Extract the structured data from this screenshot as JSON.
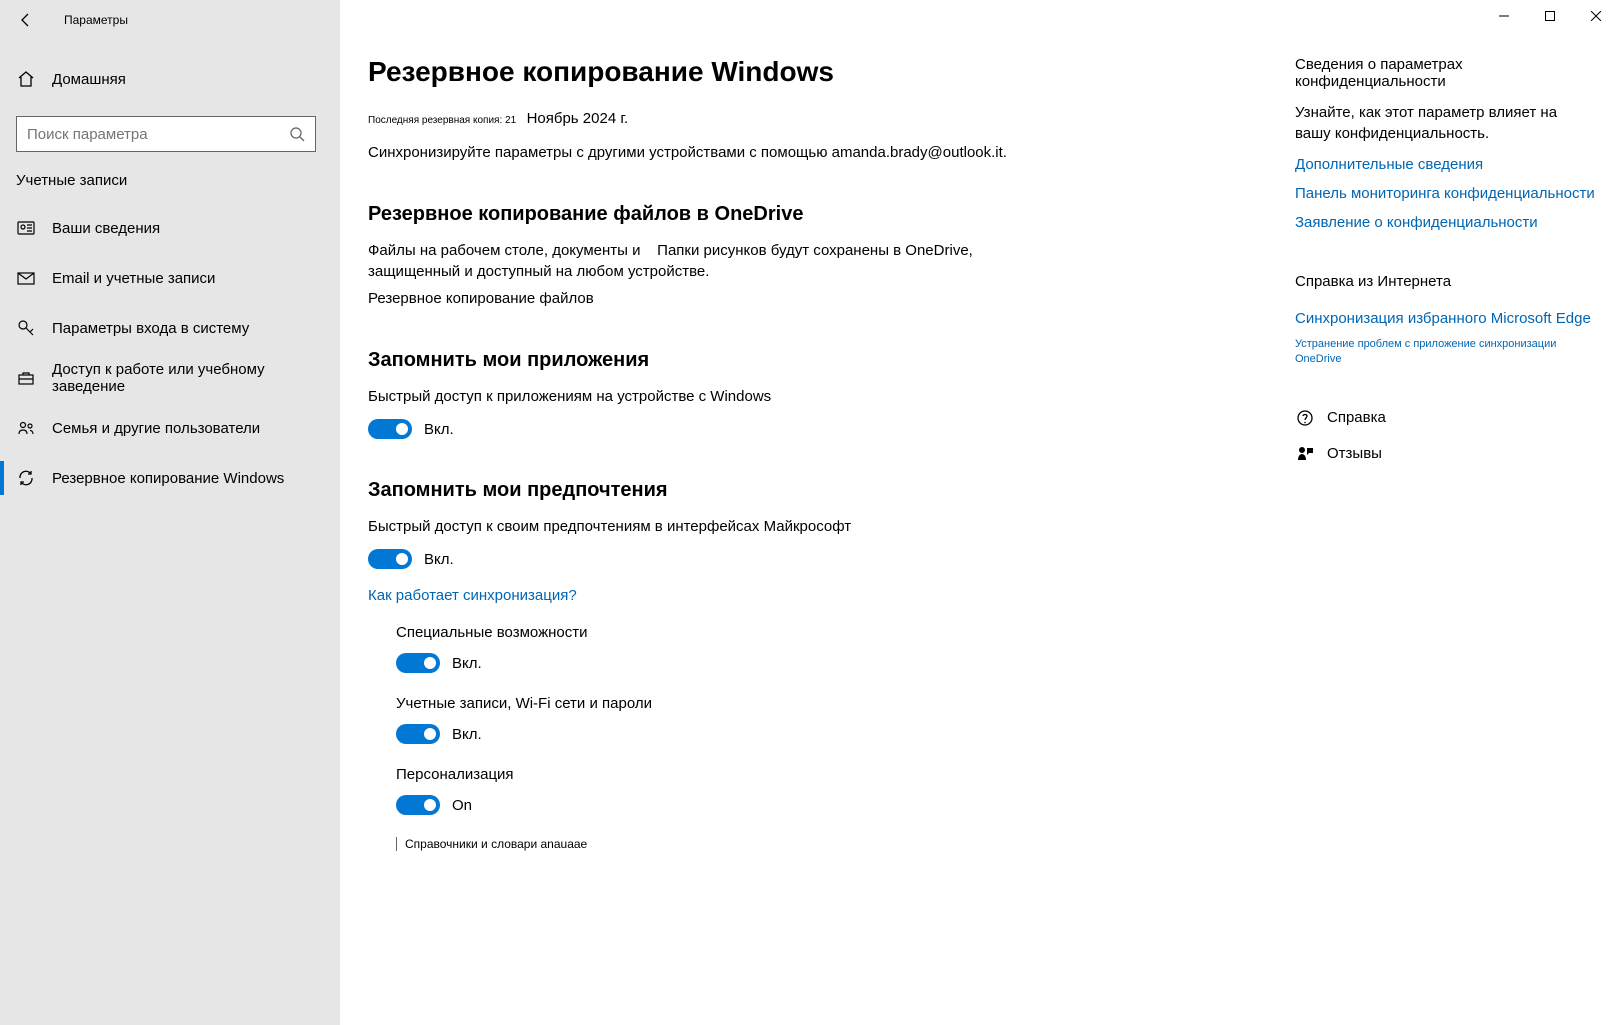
{
  "titlebar": {
    "title": "Параметры"
  },
  "home_label": "Домашняя",
  "search": {
    "placeholder": "Поиск параметра"
  },
  "accounts_section": "Учетные записи",
  "nav": {
    "your_info": "Ваши сведения",
    "email": "Email и учетные записи",
    "signin": "Параметры входа в систему",
    "work": "Доступ к работе или учебному заведение",
    "family": "Семья и другие пользователи",
    "backup": "Резервное копирование Windows"
  },
  "page": {
    "title": "Резервное копирование Windows",
    "last_backup_label": "Последняя резервная копия: 21",
    "last_backup_date": "Ноябрь 2024 г.",
    "sync_desc": "Синхронизируйте параметры с другими устройствами с помощью amanda.brady@outlook.it.",
    "onedrive_h": "Резервное копирование файлов в OneDrive",
    "onedrive_desc1": "Файлы на рабочем столе, документы и",
    "onedrive_desc2": "Папки рисунков будут сохранены в OneDrive, защищенный и доступный на любом устройстве.",
    "onedrive_desc3": "Резервное копирование файлов",
    "apps_h": "Запомнить мои приложения",
    "apps_desc": "Быстрый доступ к приложениям на устройстве с Windows",
    "prefs_h": "Запомнить мои предпочтения",
    "prefs_desc": "Быстрый доступ к своим предпочтениям в интерфейсах Майкрософт",
    "how_sync": "Как работает синхронизация?",
    "accessibility": "Специальные возможности",
    "accounts_wifi": "Учетные записи, Wi-Fi сети и пароли",
    "personalization": "Персонализация",
    "dictionaries": "Справочники и словари anauaae",
    "toggle_on": "Вкл.",
    "toggle_on_en": "On"
  },
  "side": {
    "privacy_h": "Сведения о параметрах конфиденциальности",
    "privacy_p": "Узнайте, как этот параметр влияет на вашу конфиденциальность.",
    "more_info": "Дополнительные сведения",
    "dashboard": "Панель мониторинга конфиденциальности",
    "statement": "Заявление о конфиденциальности",
    "help_h": "Справка из Интернета",
    "edge_sync": "Синхронизация избранного Microsoft Edge",
    "onedrive_fix": "Устранение проблем с приложение синхронизации OneDrive",
    "help": "Справка",
    "feedback": "Отзывы"
  }
}
